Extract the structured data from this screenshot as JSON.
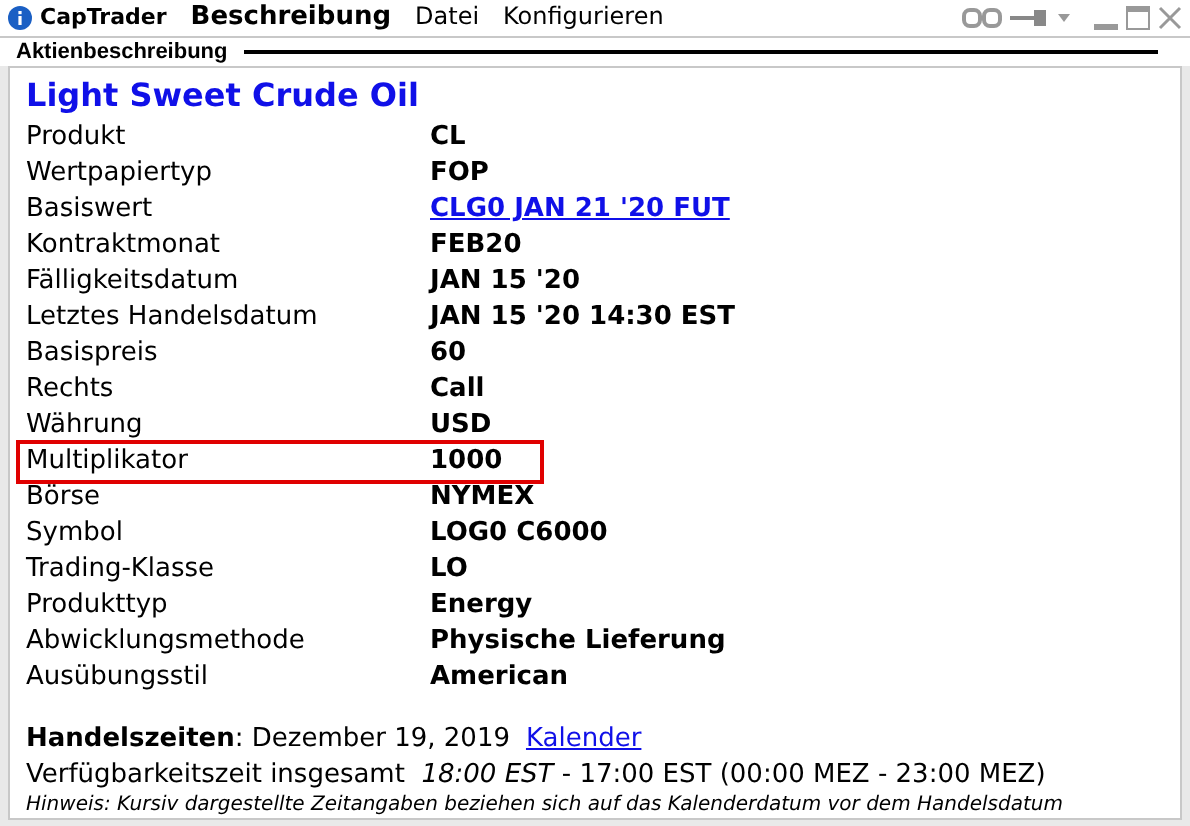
{
  "title_bar": {
    "app": "CapTrader",
    "menus": [
      {
        "label": "Beschreibung",
        "selected": true
      },
      {
        "label": "Datei",
        "selected": false
      },
      {
        "label": "Konfigurieren",
        "selected": false
      }
    ]
  },
  "section": {
    "title": "Aktienbeschreibung"
  },
  "heading": "Light Sweet Crude Oil",
  "rows": [
    {
      "label": "Produkt",
      "value": "CL",
      "link": false,
      "highlighted": false
    },
    {
      "label": "Wertpapiertyp",
      "value": "FOP",
      "link": false,
      "highlighted": false
    },
    {
      "label": "Basiswert",
      "value": "CLG0 JAN 21 '20 FUT",
      "link": true,
      "highlighted": false
    },
    {
      "label": "Kontraktmonat",
      "value": "FEB20",
      "link": false,
      "highlighted": false
    },
    {
      "label": "Fälligkeitsdatum",
      "value": "JAN 15 '20",
      "link": false,
      "highlighted": false
    },
    {
      "label": "Letztes Handelsdatum",
      "value": "JAN 15 '20 14:30 EST",
      "link": false,
      "highlighted": false
    },
    {
      "label": "Basispreis",
      "value": "60",
      "link": false,
      "highlighted": false
    },
    {
      "label": "Rechts",
      "value": "Call",
      "link": false,
      "highlighted": false
    },
    {
      "label": "Währung",
      "value": "USD",
      "link": false,
      "highlighted": false
    },
    {
      "label": "Multiplikator",
      "value": "1000",
      "link": false,
      "highlighted": true
    },
    {
      "label": "Börse",
      "value": "NYMEX",
      "link": false,
      "highlighted": false
    },
    {
      "label": "Symbol",
      "value": "LOG0 C6000",
      "link": false,
      "highlighted": false
    },
    {
      "label": "Trading-Klasse",
      "value": "LO",
      "link": false,
      "highlighted": false
    },
    {
      "label": "Produkttyp",
      "value": "Energy",
      "link": false,
      "highlighted": false
    },
    {
      "label": "Abwicklungsmethode",
      "value": "Physische Lieferung",
      "link": false,
      "highlighted": false
    },
    {
      "label": "Ausübungsstil",
      "value": "American",
      "link": false,
      "highlighted": false
    }
  ],
  "trading_hours": {
    "text": "**Handelszeiten**: Dezember 19, 2019",
    "link": "Kalender"
  },
  "availability": "Verfügbarkeitszeit insgesamt  *18:00 EST* - 17:00 EST (00:00 MEZ - 23:00 MEZ)",
  "note": "Hinweis: Kursiv dargestellte Zeitangaben beziehen sich auf das Kalenderdatum vor dem Handelsdatum"
}
